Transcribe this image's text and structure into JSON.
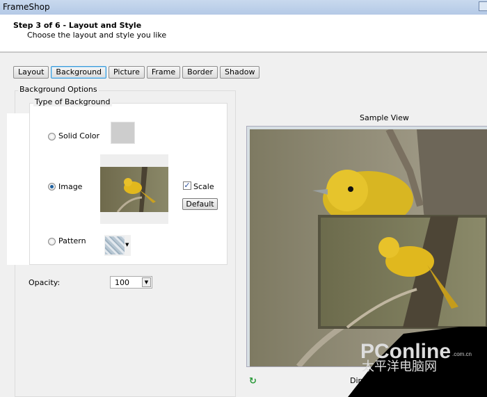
{
  "window": {
    "title": "FrameShop"
  },
  "header": {
    "step": "Step 3 of 6 - Layout and Style",
    "subtitle": "Choose the layout and style you like"
  },
  "tabs": [
    {
      "label": "Layout"
    },
    {
      "label": "Background",
      "active": true
    },
    {
      "label": "Picture"
    },
    {
      "label": "Frame"
    },
    {
      "label": "Border"
    },
    {
      "label": "Shadow"
    }
  ],
  "background_options": {
    "group_label": "Background Options",
    "type_label": "Type of Background",
    "solid_color": {
      "label": "Solid Color",
      "selected": false,
      "color": "#cdcdcd"
    },
    "image": {
      "label": "Image",
      "selected": true,
      "scale_label": "Scale",
      "scale_checked": true,
      "default_label": "Default"
    },
    "pattern": {
      "label": "Pattern",
      "selected": false
    }
  },
  "opacity": {
    "label": "Opacity:",
    "value": "100"
  },
  "sample": {
    "label": "Sample View",
    "dimensions_label": "Dim"
  },
  "watermark": {
    "brand": "PConline",
    "domain": ".com.cn",
    "cn": "太平洋电脑网"
  }
}
